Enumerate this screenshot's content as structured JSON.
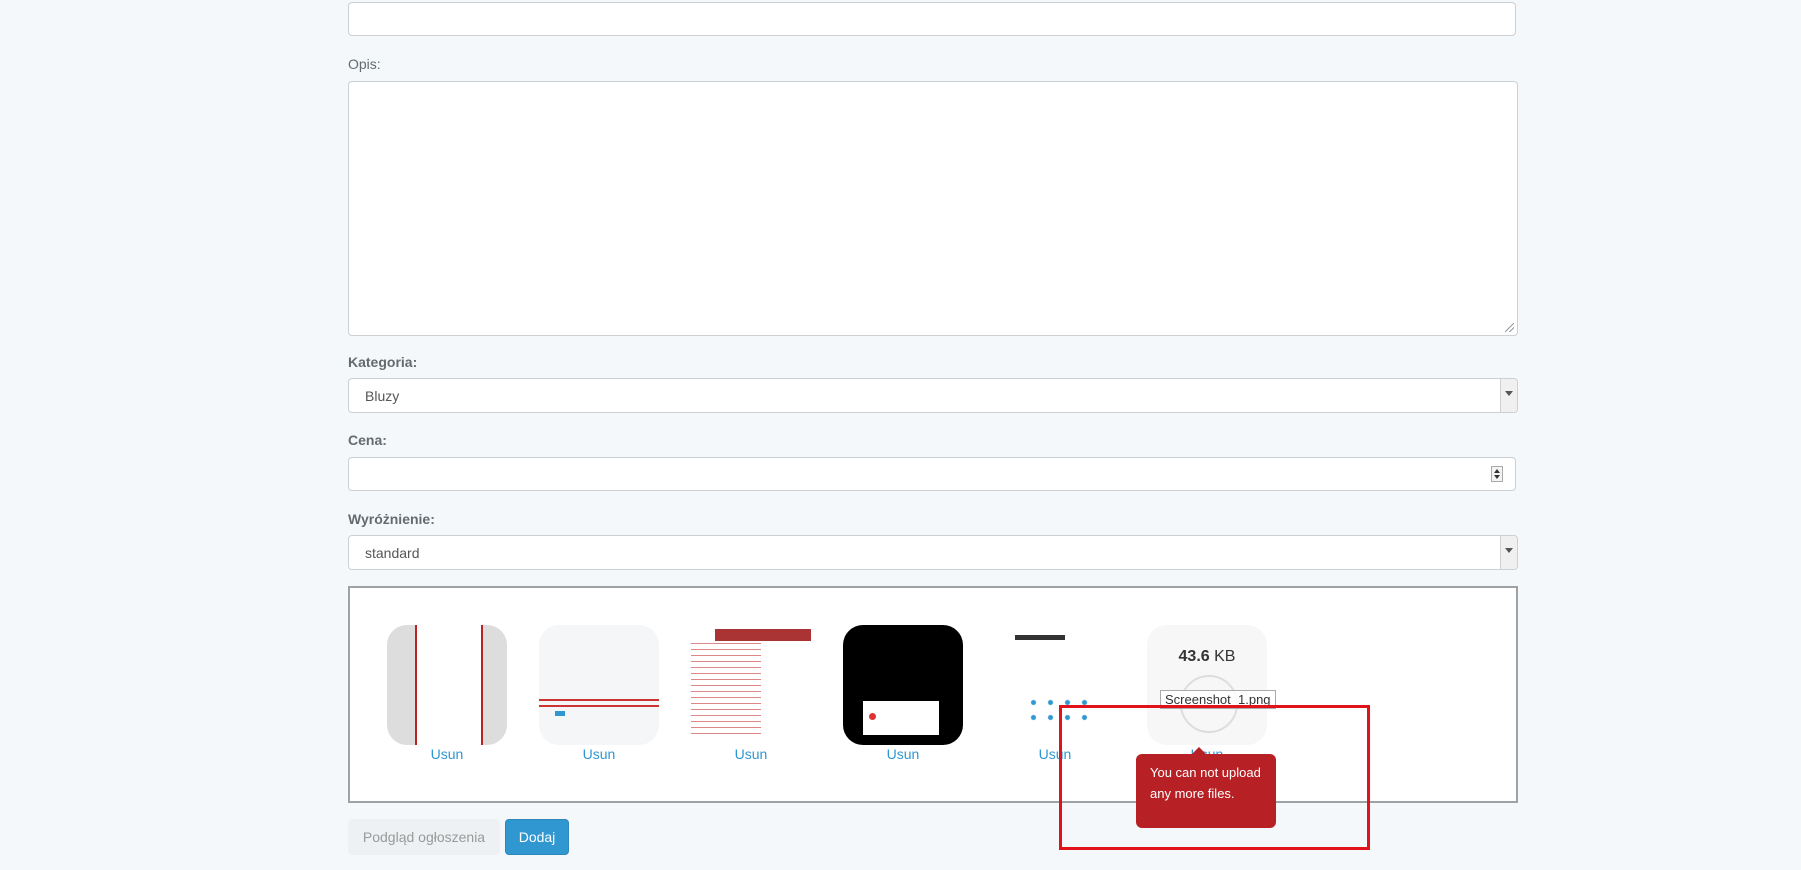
{
  "form": {
    "description_label": "Opis:",
    "category_label": "Kategoria:",
    "category_value": "Bluzy",
    "price_label": "Cena:",
    "highlight_label": "Wyróżnienie:",
    "highlight_value": "standard"
  },
  "uploads": {
    "remove_label": "Usun",
    "files": [
      {
        "remove": "Usun"
      },
      {
        "remove": "Usun"
      },
      {
        "remove": "Usun"
      },
      {
        "remove": "Usun"
      },
      {
        "remove": "Usun"
      },
      {
        "size_number": "43.6",
        "size_unit": "KB",
        "name": "Screenshot_1.png",
        "remove": "Usun"
      }
    ],
    "error_message": "You can not upload any more files."
  },
  "actions": {
    "preview_label": "Podgląd ogłoszenia",
    "add_label": "Dodaj"
  },
  "colors": {
    "primary": "#3097d1",
    "error": "#b72025",
    "highlight_box": "#e2121b"
  }
}
